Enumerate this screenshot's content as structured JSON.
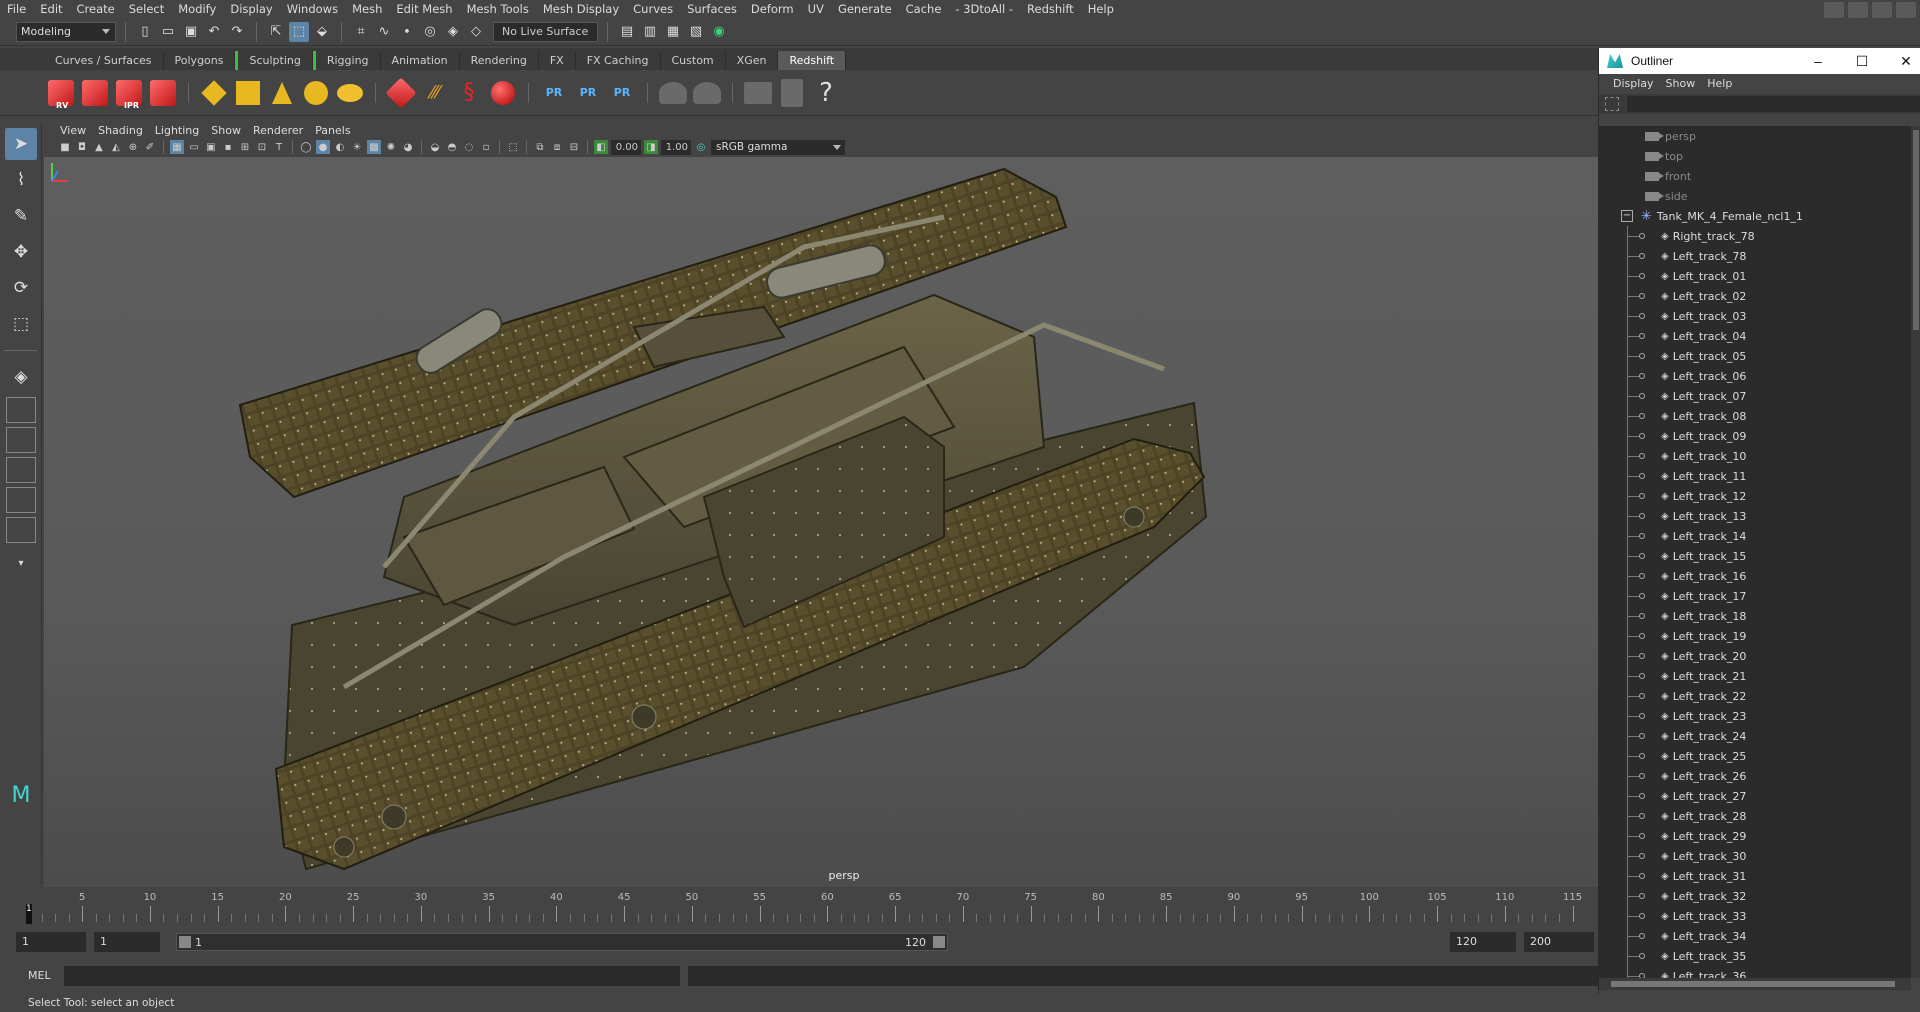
{
  "menu": [
    "File",
    "Edit",
    "Create",
    "Select",
    "Modify",
    "Display",
    "Windows",
    "Mesh",
    "Edit Mesh",
    "Mesh Tools",
    "Mesh Display",
    "Curves",
    "Surfaces",
    "Deform",
    "UV",
    "Generate",
    "Cache",
    "- 3DtoAll -",
    "Redshift",
    "Help"
  ],
  "status": {
    "mode": "Modeling",
    "live_surface": "No Live Surface"
  },
  "shelf_tabs": [
    "Curves / Surfaces",
    "Polygons",
    "Sculpting",
    "Rigging",
    "Animation",
    "Rendering",
    "FX",
    "FX Caching",
    "Custom",
    "XGen",
    "Redshift"
  ],
  "shelf_active_tab": "Redshift",
  "shelf_icons": {
    "rv": "RV",
    "ipr": "IPR",
    "pr": "PR",
    "log": "LOG",
    "help": "?"
  },
  "panel_menu": [
    "View",
    "Shading",
    "Lighting",
    "Show",
    "Renderer",
    "Panels"
  ],
  "panel_toolbar": {
    "exposure": "0.00",
    "gamma_val": "1.00",
    "color_space": "sRGB gamma"
  },
  "viewport": {
    "camera_label": "persp"
  },
  "timeline": {
    "ticks": [
      "5",
      "10",
      "15",
      "20",
      "25",
      "30",
      "35",
      "40",
      "45",
      "50",
      "55",
      "60",
      "65",
      "70",
      "75",
      "80",
      "85",
      "90",
      "95",
      "100",
      "105",
      "110",
      "115"
    ],
    "current": "1",
    "start_field": "1",
    "current_field": "1",
    "range_start": "1",
    "range_end": "120",
    "end_field": "120",
    "max_field": "200"
  },
  "cmd": {
    "label": "MEL"
  },
  "help_line": "Select Tool: select an object",
  "outliner": {
    "title": "Outliner",
    "menu": [
      "Display",
      "Show",
      "Help"
    ],
    "cameras": [
      "persp",
      "top",
      "front",
      "side"
    ],
    "group": "Tank_MK_4_Female_ncl1_1",
    "children": [
      "Right_track_78",
      "Left_track_78",
      "Left_track_01",
      "Left_track_02",
      "Left_track_03",
      "Left_track_04",
      "Left_track_05",
      "Left_track_06",
      "Left_track_07",
      "Left_track_08",
      "Left_track_09",
      "Left_track_10",
      "Left_track_11",
      "Left_track_12",
      "Left_track_13",
      "Left_track_14",
      "Left_track_15",
      "Left_track_16",
      "Left_track_17",
      "Left_track_18",
      "Left_track_19",
      "Left_track_20",
      "Left_track_21",
      "Left_track_22",
      "Left_track_23",
      "Left_track_24",
      "Left_track_25",
      "Left_track_26",
      "Left_track_27",
      "Left_track_28",
      "Left_track_29",
      "Left_track_30",
      "Left_track_31",
      "Left_track_32",
      "Left_track_33",
      "Left_track_34",
      "Left_track_35",
      "Left_track_36"
    ]
  }
}
